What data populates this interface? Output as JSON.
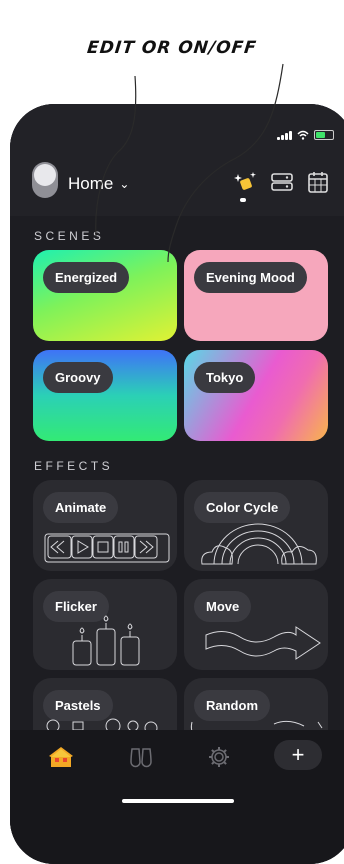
{
  "annotation": {
    "text": "EDIT OR ON/OFF"
  },
  "header": {
    "title": "Home",
    "chevron_icon": "chevron-down-icon",
    "icons": [
      "scenes-sparkle-icon",
      "devices-icon",
      "calendar-icon"
    ]
  },
  "scenes": {
    "label": "SCENES",
    "items": [
      {
        "label": "Energized",
        "colors": [
          "#27e6a4",
          "#d8f532"
        ]
      },
      {
        "label": "Evening Mood",
        "colors": [
          "#f7a8bd",
          "#f4a2b7"
        ]
      },
      {
        "label": "Groovy",
        "colors": [
          "#4a7cf5",
          "#25e28f"
        ]
      },
      {
        "label": "Tokyo",
        "colors": [
          "#5ad2e6",
          "#f04fc6",
          "#f9b24a"
        ]
      }
    ]
  },
  "effects": {
    "label": "EFFECTS",
    "items": [
      {
        "label": "Animate",
        "icon": "playback-controls-icon"
      },
      {
        "label": "Color Cycle",
        "icon": "rainbow-icon"
      },
      {
        "label": "Flicker",
        "icon": "candles-icon"
      },
      {
        "label": "Move",
        "icon": "arrow-wave-icon"
      },
      {
        "label": "Pastels",
        "icon": "pastel-sweets-icon"
      },
      {
        "label": "Random",
        "icon": "random-shapes-icon"
      }
    ]
  },
  "tabbar": {
    "tabs": [
      "home-tab-icon",
      "discover-tab-icon",
      "settings-tab-icon"
    ],
    "add_label": "+"
  }
}
